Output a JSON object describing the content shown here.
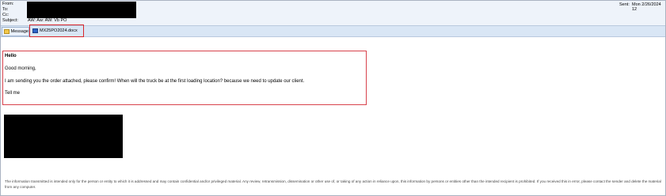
{
  "header": {
    "from_label": "From:",
    "to_label": "To:",
    "cc_label": "Cc:",
    "subject_label": "Subject:",
    "subject_value": "AW: Aw: AW: Vb PO",
    "sent_label": "Sent:",
    "sent_value": "Mon 2/26/2024 12"
  },
  "tabs": {
    "message_label": "Message",
    "attachment_label": "MX25PO2024.docx"
  },
  "body": {
    "greeting": "Hello",
    "line1": "Good morning,",
    "line2": "I am sending you the order attached, please confirm! When will the truck be at the first loading location? because we need to update our client.",
    "line3": "Tell me"
  },
  "footer": {
    "disclaimer": "The information transmitted is intended only for the person or entity to which it is addressed and may contain confidential and/or privileged material. Any review, retransmission, dissemination or other use of, or taking of any action in reliance upon, this information by persons or entities other than the intended recipient is prohibited. If you received this in error, please contact the sender and delete the material from any computer."
  },
  "colors": {
    "header_bg": "#eef3fa",
    "tab_bar_bg": "#d9e6f5",
    "highlight_red": "#d9252b"
  },
  "icons": {
    "message_tab_icon": "envelope-icon",
    "attachment_icon": "word-document-icon"
  }
}
